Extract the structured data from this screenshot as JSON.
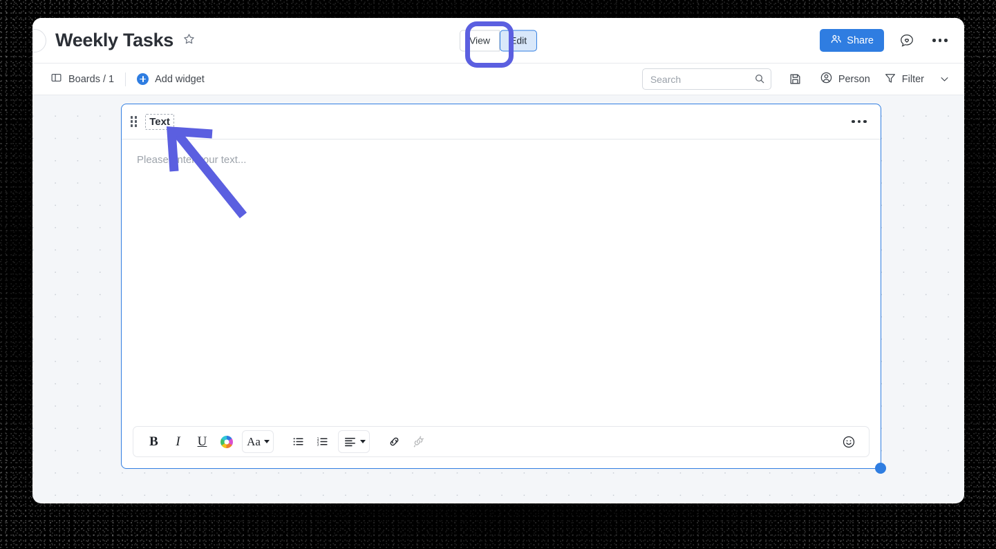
{
  "window": {
    "header": {
      "back_icon": "back-circle-icon",
      "title": "Weekly Tasks",
      "favorite_icon": "star-outline-icon",
      "view_mode": {
        "options": [
          "View",
          "Edit"
        ],
        "selected": "Edit",
        "view_label": "View",
        "edit_label": "Edit"
      },
      "share_label": "Share",
      "share_icon": "people-icon",
      "share_color": "#2f7de1",
      "feedback_icon": "chat-heart-icon",
      "more_icon": "more-horizontal-icon"
    },
    "subbar": {
      "boards_label": "Boards / 1",
      "boards_icon": "board-panel-icon",
      "add_widget_label": "Add widget",
      "add_widget_icon": "plus-circle-icon",
      "search": {
        "placeholder": "Search",
        "value": "",
        "icon": "search-icon"
      },
      "save_icon": "floppy-save-icon",
      "person_label": "Person",
      "person_icon": "person-circle-icon",
      "filter_label": "Filter",
      "filter_icon": "funnel-icon",
      "filter_chevron_icon": "chevron-down-icon"
    },
    "canvas": {
      "background_color": "#f4f6f9",
      "dot_color": "#c8cdd4",
      "widget": {
        "drag_handle_icon": "drag-dots-icon",
        "title": "Text",
        "menu_icon": "more-horizontal-icon",
        "body_placeholder": "Please enter your text...",
        "selection_color": "#2f7de1",
        "resize_handle_icon": "resize-handle-icon",
        "toolbar": {
          "bold_label": "B",
          "italic_label": "I",
          "underline_label": "U",
          "color_icon": "color-wheel-icon",
          "font_label": "Aa",
          "font_caret_icon": "caret-down-icon",
          "bullet_list_icon": "bullet-list-icon",
          "numbered_list_icon": "numbered-list-icon",
          "align_icon": "align-left-icon",
          "align_caret_icon": "caret-down-icon",
          "link_icon": "link-icon",
          "unlink_icon": "unlink-icon",
          "unlink_disabled": true,
          "emoji_icon": "emoji-smiley-icon"
        }
      }
    }
  },
  "annotations": {
    "highlight": {
      "target": "Edit",
      "color": "#5b5fe0",
      "shape": "rounded-rectangle-ring"
    },
    "arrow": {
      "target": "Text",
      "color": "#5b5fe0",
      "direction": "up-left"
    }
  }
}
